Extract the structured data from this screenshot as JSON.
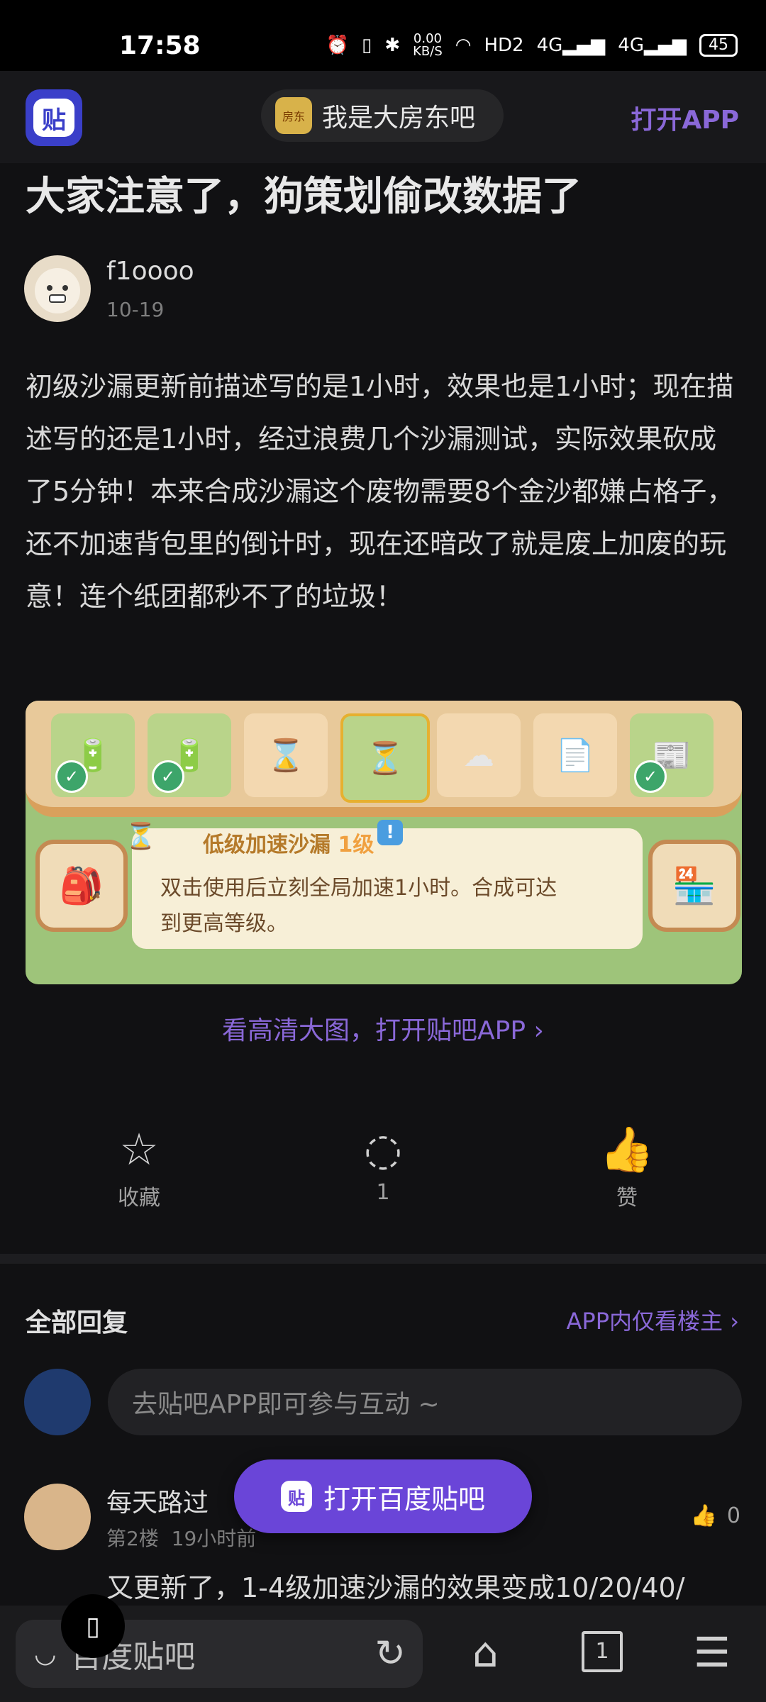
{
  "status": {
    "time": "17:58",
    "net_speed": "0.00",
    "net_unit": "KB/S",
    "signal1": "4G",
    "signal2": "4G",
    "hd": "HD2",
    "battery": "45"
  },
  "header": {
    "logo_char": "贴",
    "forum_icon_text": "房东",
    "forum_name": "我是大房东吧",
    "open_app": "打开APP"
  },
  "post": {
    "title": "大家注意了，狗策划偷改数据了",
    "author": "f1oooo",
    "date": "10-19",
    "body": "初级沙漏更新前描述写的是1小时，效果也是1小时；现在描述写的还是1小时，经过浪费几个沙漏测试，实际效果砍成了5分钟！本来合成沙漏这个废物需要8个金沙都嫌占格子，还不加速背包里的倒计时，现在还暗改了就是废上加废的玩意！连个纸团都秒不了的垃圾！",
    "image": {
      "item_title": "低级加速沙漏",
      "item_level": "1级",
      "item_desc": "双击使用后立刻全局加速1小时。合成可达到更高等级。",
      "excl": "!"
    },
    "view_hd": "看高清大图，打开贴吧APP ›"
  },
  "actions": {
    "favorite": "收藏",
    "comments": "1",
    "like": "赞"
  },
  "replies": {
    "heading": "全部回复",
    "op_only": "APP内仅看楼主 ›",
    "input_placeholder": "去贴吧APP即可参与互动 ~",
    "first": {
      "user": "每天路过",
      "floor": "第2楼",
      "time": "19小时前",
      "likes": "0",
      "text": "又更新了，1-4级加速沙漏的效果变成10/20/40/"
    }
  },
  "open_tieba": "打开百度贴吧",
  "browser": {
    "address": "百度贴吧",
    "tab_count": "1"
  }
}
